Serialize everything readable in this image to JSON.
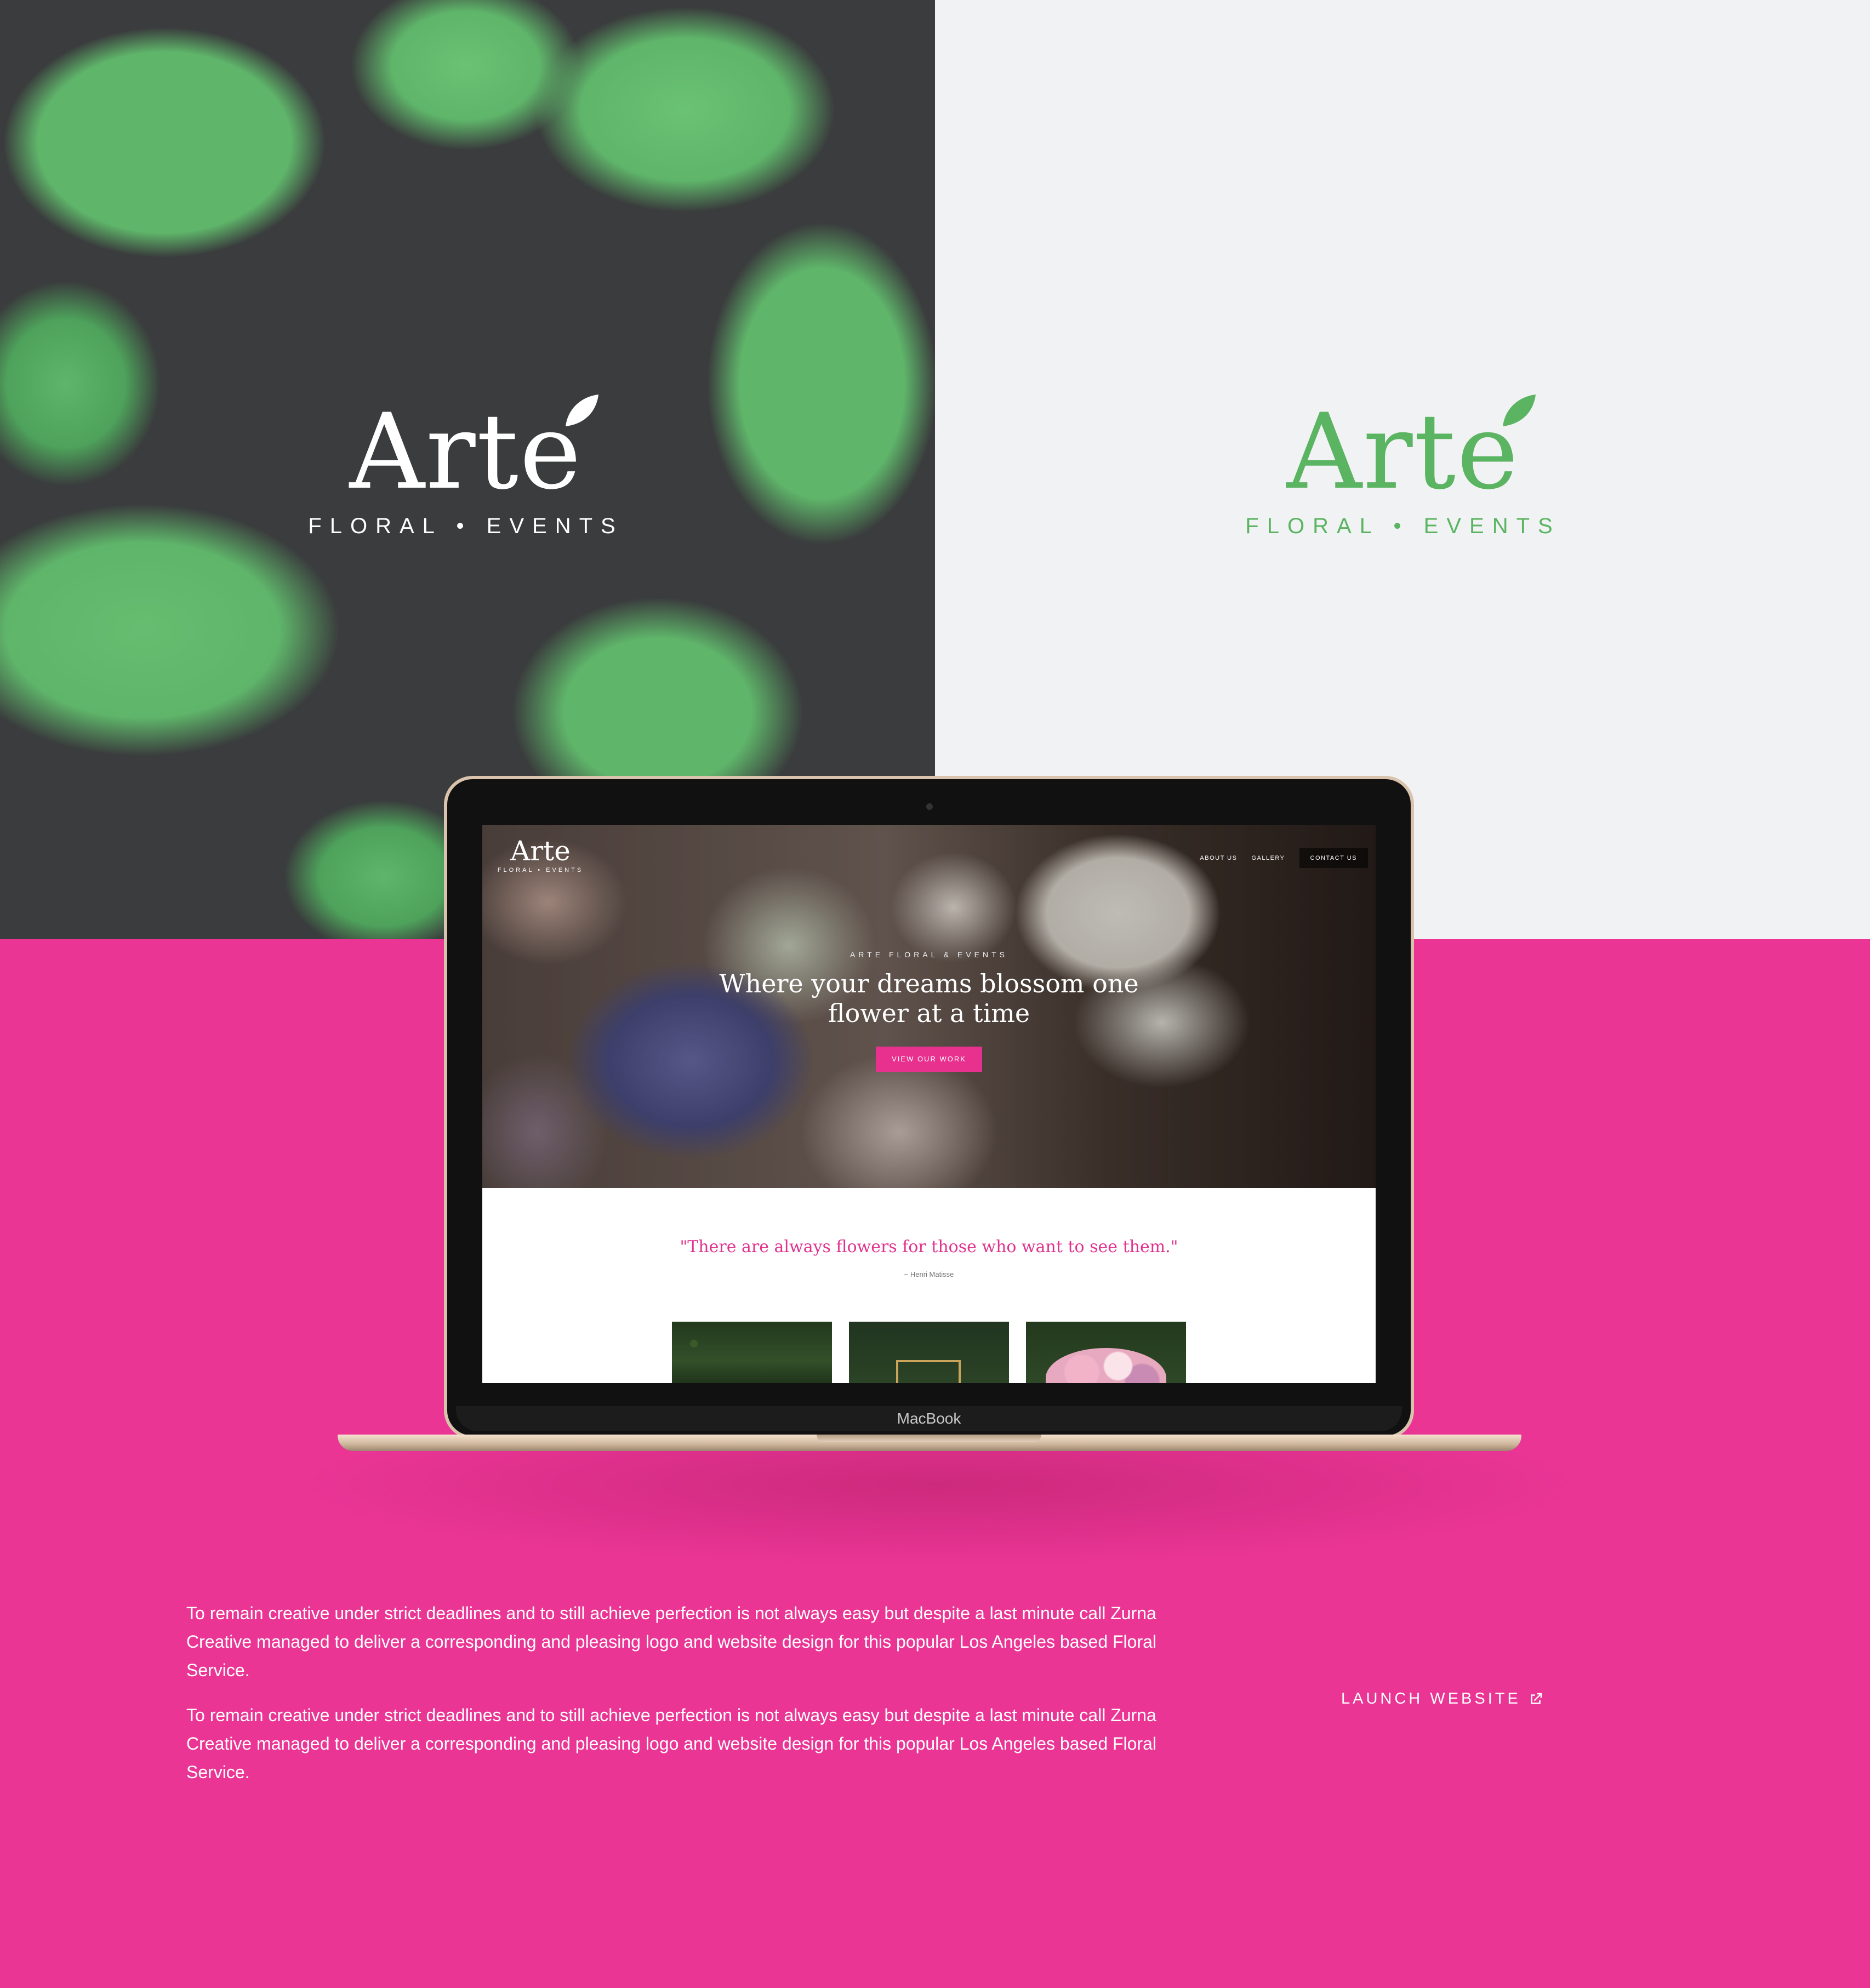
{
  "brand": {
    "name": "Arte",
    "tagline": "FLORAL • EVENTS",
    "green": "#5bb461",
    "pink": "#e8318f"
  },
  "laptop": {
    "label": "MacBook"
  },
  "site": {
    "logo_name": "Arte",
    "logo_tagline": "FLORAL • EVENTS",
    "nav": {
      "about": "ABOUT US",
      "gallery": "GALLERY",
      "contact": "CONTACT US"
    },
    "hero": {
      "eyebrow": "ARTE FLORAL & EVENTS",
      "headline": "Where your dreams blossom one flower at a time",
      "button": "VIEW OUR WORK"
    },
    "quote": "\"There are always flowers for those who want to see them.\"",
    "quote_author": "~ Henri Matisse"
  },
  "description": {
    "paragraphs": [
      "To remain creative under strict deadlines and to still achieve perfection is not always easy but despite a last minute call Zurna Creative managed to deliver a corresponding and pleasing logo and website design for this popular Los Angeles based Floral Service.",
      "To remain creative under strict deadlines and to still achieve perfection is not always easy but despite a last minute call Zurna Creative managed to deliver a corresponding and pleasing logo and website design for this popular Los Angeles based Floral Service."
    ]
  },
  "launch": {
    "label": "LAUNCH WEBSITE",
    "icon": "external-link-icon"
  }
}
